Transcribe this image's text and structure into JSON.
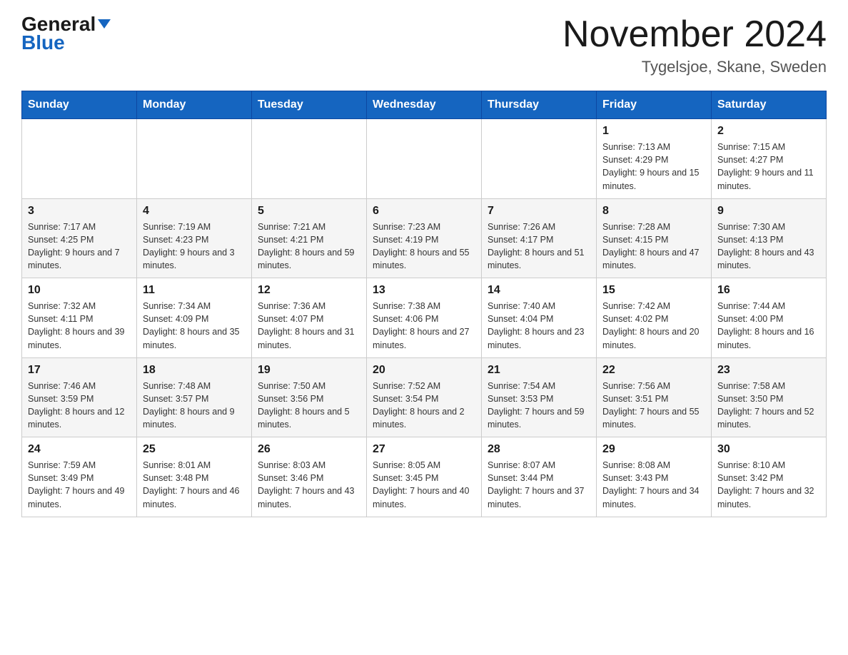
{
  "header": {
    "logo_line1": "General",
    "logo_line2": "Blue",
    "month_year": "November 2024",
    "location": "Tygelsjoe, Skane, Sweden"
  },
  "weekdays": [
    "Sunday",
    "Monday",
    "Tuesday",
    "Wednesday",
    "Thursday",
    "Friday",
    "Saturday"
  ],
  "weeks": [
    [
      {
        "day": "",
        "info": ""
      },
      {
        "day": "",
        "info": ""
      },
      {
        "day": "",
        "info": ""
      },
      {
        "day": "",
        "info": ""
      },
      {
        "day": "",
        "info": ""
      },
      {
        "day": "1",
        "info": "Sunrise: 7:13 AM\nSunset: 4:29 PM\nDaylight: 9 hours and 15 minutes."
      },
      {
        "day": "2",
        "info": "Sunrise: 7:15 AM\nSunset: 4:27 PM\nDaylight: 9 hours and 11 minutes."
      }
    ],
    [
      {
        "day": "3",
        "info": "Sunrise: 7:17 AM\nSunset: 4:25 PM\nDaylight: 9 hours and 7 minutes."
      },
      {
        "day": "4",
        "info": "Sunrise: 7:19 AM\nSunset: 4:23 PM\nDaylight: 9 hours and 3 minutes."
      },
      {
        "day": "5",
        "info": "Sunrise: 7:21 AM\nSunset: 4:21 PM\nDaylight: 8 hours and 59 minutes."
      },
      {
        "day": "6",
        "info": "Sunrise: 7:23 AM\nSunset: 4:19 PM\nDaylight: 8 hours and 55 minutes."
      },
      {
        "day": "7",
        "info": "Sunrise: 7:26 AM\nSunset: 4:17 PM\nDaylight: 8 hours and 51 minutes."
      },
      {
        "day": "8",
        "info": "Sunrise: 7:28 AM\nSunset: 4:15 PM\nDaylight: 8 hours and 47 minutes."
      },
      {
        "day": "9",
        "info": "Sunrise: 7:30 AM\nSunset: 4:13 PM\nDaylight: 8 hours and 43 minutes."
      }
    ],
    [
      {
        "day": "10",
        "info": "Sunrise: 7:32 AM\nSunset: 4:11 PM\nDaylight: 8 hours and 39 minutes."
      },
      {
        "day": "11",
        "info": "Sunrise: 7:34 AM\nSunset: 4:09 PM\nDaylight: 8 hours and 35 minutes."
      },
      {
        "day": "12",
        "info": "Sunrise: 7:36 AM\nSunset: 4:07 PM\nDaylight: 8 hours and 31 minutes."
      },
      {
        "day": "13",
        "info": "Sunrise: 7:38 AM\nSunset: 4:06 PM\nDaylight: 8 hours and 27 minutes."
      },
      {
        "day": "14",
        "info": "Sunrise: 7:40 AM\nSunset: 4:04 PM\nDaylight: 8 hours and 23 minutes."
      },
      {
        "day": "15",
        "info": "Sunrise: 7:42 AM\nSunset: 4:02 PM\nDaylight: 8 hours and 20 minutes."
      },
      {
        "day": "16",
        "info": "Sunrise: 7:44 AM\nSunset: 4:00 PM\nDaylight: 8 hours and 16 minutes."
      }
    ],
    [
      {
        "day": "17",
        "info": "Sunrise: 7:46 AM\nSunset: 3:59 PM\nDaylight: 8 hours and 12 minutes."
      },
      {
        "day": "18",
        "info": "Sunrise: 7:48 AM\nSunset: 3:57 PM\nDaylight: 8 hours and 9 minutes."
      },
      {
        "day": "19",
        "info": "Sunrise: 7:50 AM\nSunset: 3:56 PM\nDaylight: 8 hours and 5 minutes."
      },
      {
        "day": "20",
        "info": "Sunrise: 7:52 AM\nSunset: 3:54 PM\nDaylight: 8 hours and 2 minutes."
      },
      {
        "day": "21",
        "info": "Sunrise: 7:54 AM\nSunset: 3:53 PM\nDaylight: 7 hours and 59 minutes."
      },
      {
        "day": "22",
        "info": "Sunrise: 7:56 AM\nSunset: 3:51 PM\nDaylight: 7 hours and 55 minutes."
      },
      {
        "day": "23",
        "info": "Sunrise: 7:58 AM\nSunset: 3:50 PM\nDaylight: 7 hours and 52 minutes."
      }
    ],
    [
      {
        "day": "24",
        "info": "Sunrise: 7:59 AM\nSunset: 3:49 PM\nDaylight: 7 hours and 49 minutes."
      },
      {
        "day": "25",
        "info": "Sunrise: 8:01 AM\nSunset: 3:48 PM\nDaylight: 7 hours and 46 minutes."
      },
      {
        "day": "26",
        "info": "Sunrise: 8:03 AM\nSunset: 3:46 PM\nDaylight: 7 hours and 43 minutes."
      },
      {
        "day": "27",
        "info": "Sunrise: 8:05 AM\nSunset: 3:45 PM\nDaylight: 7 hours and 40 minutes."
      },
      {
        "day": "28",
        "info": "Sunrise: 8:07 AM\nSunset: 3:44 PM\nDaylight: 7 hours and 37 minutes."
      },
      {
        "day": "29",
        "info": "Sunrise: 8:08 AM\nSunset: 3:43 PM\nDaylight: 7 hours and 34 minutes."
      },
      {
        "day": "30",
        "info": "Sunrise: 8:10 AM\nSunset: 3:42 PM\nDaylight: 7 hours and 32 minutes."
      }
    ]
  ]
}
